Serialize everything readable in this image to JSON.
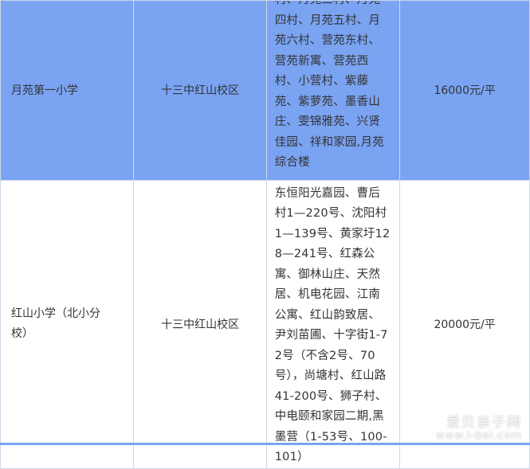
{
  "rows": [
    {
      "school": "月苑第一小学",
      "campus": "十三中红山校区",
      "area": "村、月苑三村、月苑四村、月苑五村、月苑六村、营苑东村、营苑新寓、营苑西村、小营村、紫藤苑、紫萝苑、墨香山庄、雯锦雅苑、兴贤佳园、祥和家园,月苑综合楼",
      "price": "16000元/平",
      "highlight": true
    },
    {
      "school": "红山小学（北小分校）",
      "campus": "十三中红山校区",
      "area": "东恒阳光嘉园、曹后村1—220号、沈阳村1—139号、黄家圩128—241号、红森公寓、御林山庄、天然居、机电花园、江南公寓、红山韵致居、尹刘苗圃、十字街1-72号（不含2号、70号），尚塘村、红山路41-200号、狮子村、中电颐和家园二期,黑墨营（1-53号、100-101）",
      "price": "20000元/平",
      "highlight": false
    }
  ],
  "watermark": {
    "text": "爱贝亲子网",
    "url": "www.i-bei.com"
  },
  "colors": {
    "highlight_row": "#7aa3f2",
    "border": "#cfd8e6",
    "text": "#333333"
  }
}
